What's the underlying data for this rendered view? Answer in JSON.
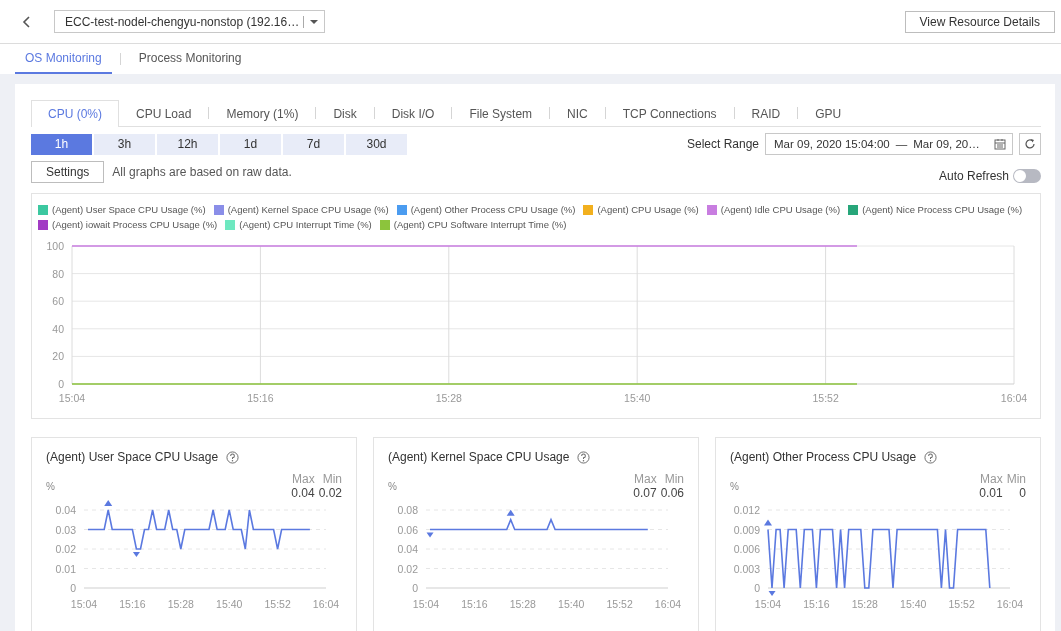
{
  "resource_select": {
    "value": "ECC-test-nodel-chengyu-nonstop (192.16…"
  },
  "view_button": "View Resource Details",
  "tabs": [
    {
      "label": "OS Monitoring",
      "selected": true
    },
    {
      "label": "Process Monitoring",
      "selected": false
    }
  ],
  "metric_tabs": [
    {
      "label": "CPU (0%)",
      "selected": true
    },
    {
      "label": "CPU Load",
      "selected": false
    },
    {
      "label": "Memory (1%)",
      "selected": false
    },
    {
      "label": "Disk",
      "selected": false
    },
    {
      "label": "Disk I/O",
      "selected": false
    },
    {
      "label": "File System",
      "selected": false
    },
    {
      "label": "NIC",
      "selected": false
    },
    {
      "label": "TCP Connections",
      "selected": false
    },
    {
      "label": "RAID",
      "selected": false
    },
    {
      "label": "GPU",
      "selected": false
    }
  ],
  "time_ranges": [
    {
      "label": "1h",
      "selected": true
    },
    {
      "label": "3h",
      "selected": false
    },
    {
      "label": "12h",
      "selected": false
    },
    {
      "label": "1d",
      "selected": false
    },
    {
      "label": "7d",
      "selected": false
    },
    {
      "label": "30d",
      "selected": false
    }
  ],
  "select_range": {
    "label": "Select Range",
    "start": "Mar 09, 2020 15:04:00",
    "separator": "—",
    "end": "Mar 09, 20…"
  },
  "settings_button": "Settings",
  "note": "All graphs are based on raw data.",
  "auto_refresh": {
    "label": "Auto Refresh",
    "on": false
  },
  "main_chart": {
    "chart_data": {
      "type": "line",
      "grid": true,
      "legend": "top",
      "ylim": [
        0,
        100
      ],
      "yticks": [
        0,
        20,
        40,
        60,
        80,
        100
      ],
      "categories": [
        "15:04",
        null,
        null,
        null,
        null,
        null,
        "15:16",
        null,
        null,
        null,
        null,
        null,
        "15:28",
        null,
        null,
        null,
        null,
        null,
        "15:40",
        null,
        null,
        null,
        null,
        null,
        "15:52",
        null,
        null,
        null,
        null,
        null,
        "16:04"
      ],
      "series": [
        {
          "name": "(Agent) User Space CPU Usage (%)",
          "color": "#3cc8a0",
          "values": [
            null,
            null,
            null,
            null,
            null,
            null,
            null,
            null,
            null,
            null,
            null,
            null,
            null,
            null,
            null,
            null,
            null,
            null,
            null,
            null,
            null,
            null,
            null,
            null,
            null,
            null,
            null,
            null,
            null,
            null,
            null
          ]
        },
        {
          "name": "(Agent) Kernel Space CPU Usage (%)",
          "color": "#8a8ee8",
          "values": [
            null,
            null,
            null,
            null,
            null,
            null,
            null,
            null,
            null,
            null,
            null,
            null,
            null,
            null,
            null,
            null,
            null,
            null,
            null,
            null,
            null,
            null,
            null,
            null,
            null,
            null,
            null,
            null,
            null,
            null,
            null
          ]
        },
        {
          "name": "(Agent) Other Process CPU Usage (%)",
          "color": "#4b9cf0",
          "values": [
            null,
            null,
            null,
            null,
            null,
            null,
            null,
            null,
            null,
            null,
            null,
            null,
            null,
            null,
            null,
            null,
            null,
            null,
            null,
            null,
            null,
            null,
            null,
            null,
            null,
            null,
            null,
            null,
            null,
            null,
            null
          ]
        },
        {
          "name": "(Agent) CPU Usage (%)",
          "color": "#f2b01e",
          "values": [
            null,
            null,
            null,
            null,
            null,
            null,
            null,
            null,
            null,
            null,
            null,
            null,
            null,
            null,
            null,
            null,
            null,
            null,
            null,
            null,
            null,
            null,
            null,
            null,
            null,
            null,
            null,
            null,
            null,
            null,
            null
          ]
        },
        {
          "name": "(Agent) Idle CPU Usage (%)",
          "color": "#c87de0",
          "values": [
            100,
            100,
            100,
            100,
            100,
            100,
            100,
            100,
            100,
            100,
            100,
            100,
            100,
            100,
            100,
            100,
            100,
            100,
            100,
            100,
            100,
            100,
            100,
            100,
            100,
            100,
            null,
            null,
            null,
            null,
            null
          ]
        },
        {
          "name": "(Agent) Nice Process CPU Usage (%)",
          "color": "#27a67a",
          "values": [
            null,
            null,
            null,
            null,
            null,
            null,
            null,
            null,
            null,
            null,
            null,
            null,
            null,
            null,
            null,
            null,
            null,
            null,
            null,
            null,
            null,
            null,
            null,
            null,
            null,
            null,
            null,
            null,
            null,
            null,
            null
          ]
        },
        {
          "name": "(Agent) iowait Process CPU Usage (%)",
          "color": "#a23bc4",
          "values": [
            null,
            null,
            null,
            null,
            null,
            null,
            null,
            null,
            null,
            null,
            null,
            null,
            null,
            null,
            null,
            null,
            null,
            null,
            null,
            null,
            null,
            null,
            null,
            null,
            null,
            null,
            null,
            null,
            null,
            null,
            null
          ]
        },
        {
          "name": "(Agent) CPU Interrupt Time (%)",
          "color": "#6ee8c0",
          "values": [
            null,
            null,
            null,
            null,
            null,
            null,
            null,
            null,
            null,
            null,
            null,
            null,
            null,
            null,
            null,
            null,
            null,
            null,
            null,
            null,
            null,
            null,
            null,
            null,
            null,
            null,
            null,
            null,
            null,
            null,
            null
          ]
        },
        {
          "name": "(Agent) CPU Software Interrupt Time (%)",
          "color": "#8cc43c",
          "values": [
            0,
            0,
            0,
            0,
            0,
            0,
            0,
            0,
            0,
            0,
            0,
            0,
            0,
            0,
            0,
            0,
            0,
            0,
            0,
            0,
            0,
            0,
            0,
            0,
            0,
            0,
            null,
            null,
            null,
            null,
            null
          ]
        }
      ]
    }
  },
  "metric_cards": [
    {
      "title": "(Agent) User Space CPU Usage",
      "unit": "%",
      "max_label": "Max",
      "min_label": "Min",
      "max": "0.04",
      "min": "0.02",
      "chart_data": {
        "type": "line",
        "grid": true,
        "ylim": [
          0,
          0.04
        ],
        "yticks": [
          0,
          0.01,
          0.02,
          0.03,
          0.04
        ],
        "categories": [
          "15:04",
          null,
          null,
          null,
          null,
          null,
          null,
          null,
          null,
          null,
          null,
          null,
          "15:16",
          null,
          null,
          null,
          null,
          null,
          null,
          null,
          null,
          null,
          null,
          null,
          "15:28",
          null,
          null,
          null,
          null,
          null,
          null,
          null,
          null,
          null,
          null,
          null,
          "15:40",
          null,
          null,
          null,
          null,
          null,
          null,
          null,
          null,
          null,
          null,
          null,
          "15:52",
          null,
          null,
          null,
          null,
          null,
          null,
          null,
          null,
          null,
          null,
          null,
          "16:04"
        ],
        "series": [
          {
            "color": "#5b79e0",
            "values": [
              null,
              0.03,
              0.03,
              0.03,
              0.03,
              0.03,
              0.04,
              0.03,
              0.03,
              0.03,
              0.03,
              0.03,
              0.03,
              0.02,
              0.02,
              0.03,
              0.03,
              0.04,
              0.03,
              0.03,
              0.03,
              0.04,
              0.03,
              0.03,
              0.02,
              0.03,
              0.03,
              0.03,
              0.03,
              0.03,
              0.03,
              0.03,
              0.04,
              0.03,
              0.03,
              0.03,
              0.04,
              0.03,
              0.03,
              0.03,
              0.02,
              0.04,
              0.03,
              0.03,
              0.03,
              0.03,
              0.03,
              0.03,
              0.02,
              0.03,
              0.03,
              0.03,
              0.03,
              0.03,
              0.03,
              0.03,
              0.03,
              null,
              null,
              null,
              null
            ]
          }
        ]
      }
    },
    {
      "title": "(Agent) Kernel Space CPU Usage",
      "unit": "%",
      "max_label": "Max",
      "min_label": "Min",
      "max": "0.07",
      "min": "0.06",
      "chart_data": {
        "type": "line",
        "grid": true,
        "ylim": [
          0,
          0.08
        ],
        "yticks": [
          0,
          0.02,
          0.04,
          0.06,
          0.08
        ],
        "categories": [
          "15:04",
          null,
          null,
          null,
          null,
          null,
          null,
          null,
          null,
          null,
          null,
          null,
          "15:16",
          null,
          null,
          null,
          null,
          null,
          null,
          null,
          null,
          null,
          null,
          null,
          "15:28",
          null,
          null,
          null,
          null,
          null,
          null,
          null,
          null,
          null,
          null,
          null,
          "15:40",
          null,
          null,
          null,
          null,
          null,
          null,
          null,
          null,
          null,
          null,
          null,
          "15:52",
          null,
          null,
          null,
          null,
          null,
          null,
          null,
          null,
          null,
          null,
          null,
          "16:04"
        ],
        "series": [
          {
            "color": "#5b79e0",
            "values": [
              null,
              0.06,
              0.06,
              0.06,
              0.06,
              0.06,
              0.06,
              0.06,
              0.06,
              0.06,
              0.06,
              0.06,
              0.06,
              0.06,
              0.06,
              0.06,
              0.06,
              0.06,
              0.06,
              0.06,
              0.06,
              0.07,
              0.06,
              0.06,
              0.06,
              0.06,
              0.06,
              0.06,
              0.06,
              0.06,
              0.06,
              0.07,
              0.06,
              0.06,
              0.06,
              0.06,
              0.06,
              0.06,
              0.06,
              0.06,
              0.06,
              0.06,
              0.06,
              0.06,
              0.06,
              0.06,
              0.06,
              0.06,
              0.06,
              0.06,
              0.06,
              0.06,
              0.06,
              0.06,
              0.06,
              0.06,
              null,
              null,
              null,
              null,
              null
            ]
          }
        ]
      }
    },
    {
      "title": "(Agent) Other Process CPU Usage",
      "unit": "%",
      "max_label": "Max",
      "min_label": "Min",
      "max": "0.01",
      "min": "0",
      "chart_data": {
        "type": "line",
        "grid": true,
        "ylim": [
          0,
          0.012
        ],
        "yticks": [
          0,
          0.003,
          0.006,
          0.009,
          0.012
        ],
        "categories": [
          "15:04",
          null,
          null,
          null,
          null,
          null,
          null,
          null,
          null,
          null,
          null,
          null,
          "15:16",
          null,
          null,
          null,
          null,
          null,
          null,
          null,
          null,
          null,
          null,
          null,
          "15:28",
          null,
          null,
          null,
          null,
          null,
          null,
          null,
          null,
          null,
          null,
          null,
          "15:40",
          null,
          null,
          null,
          null,
          null,
          null,
          null,
          null,
          null,
          null,
          null,
          "15:52",
          null,
          null,
          null,
          null,
          null,
          null,
          null,
          null,
          null,
          null,
          null,
          "16:04"
        ],
        "series": [
          {
            "color": "#5b79e0",
            "values": [
              0.009,
              0,
              0.009,
              0.009,
              0,
              0.009,
              0.009,
              0.009,
              0,
              0.009,
              0.009,
              0.009,
              0,
              0.009,
              0.009,
              0.009,
              0.009,
              0,
              0.009,
              0,
              0.009,
              0.009,
              0.009,
              0.009,
              0,
              0,
              0.009,
              0.009,
              0.009,
              0.009,
              0.009,
              0,
              0.009,
              0.009,
              0.009,
              0.009,
              0.009,
              0.009,
              0.009,
              0.009,
              0.009,
              0.009,
              0.009,
              0,
              0.009,
              0,
              0,
              0.009,
              0.009,
              0.009,
              0.009,
              0.009,
              0.009,
              0.009,
              0.009,
              0,
              null,
              null,
              null,
              null,
              null
            ]
          }
        ]
      }
    }
  ]
}
